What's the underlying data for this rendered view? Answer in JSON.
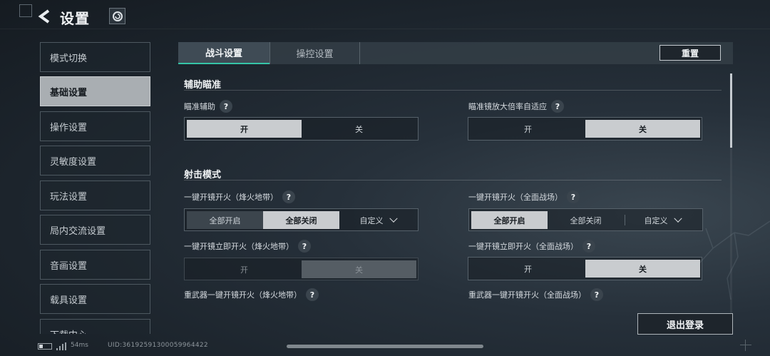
{
  "header": {
    "title": "设置"
  },
  "sidebar": {
    "items": [
      {
        "label": "模式切换",
        "active": false
      },
      {
        "label": "基础设置",
        "active": true
      },
      {
        "label": "操作设置",
        "active": false
      },
      {
        "label": "灵敏度设置",
        "active": false
      },
      {
        "label": "玩法设置",
        "active": false
      },
      {
        "label": "局内交流设置",
        "active": false
      },
      {
        "label": "音画设置",
        "active": false
      },
      {
        "label": "载具设置",
        "active": false
      },
      {
        "label": "下载中心",
        "active": false
      }
    ]
  },
  "tabs": [
    {
      "label": "战斗设置",
      "selected": true
    },
    {
      "label": "操控设置",
      "selected": false
    }
  ],
  "reset_label": "重置",
  "sections": {
    "aim_assist": {
      "title": "辅助瞄准",
      "left": {
        "label": "瞄准辅助",
        "on": "开",
        "off": "关",
        "value": "开"
      },
      "right": {
        "label": "瞄准镜放大倍率自适应",
        "on": "开",
        "off": "关",
        "value": "关"
      }
    },
    "fire_mode": {
      "title": "射击模式",
      "scope_fire_left": {
        "label": "一键开镜开火（烽火地带）",
        "options": [
          "全部开启",
          "全部关闭",
          "自定义"
        ],
        "value": "全部关闭"
      },
      "scope_fire_right": {
        "label": "一键开镜开火（全面战场）",
        "options": [
          "全部开启",
          "全部关闭",
          "自定义"
        ],
        "value": "全部开启"
      },
      "instant_fire_left": {
        "label": "一键开镜立即开火（烽火地带）",
        "on": "开",
        "off": "关",
        "value": "关",
        "disabled": true
      },
      "instant_fire_right": {
        "label": "一键开镜立即开火（全面战场）",
        "on": "开",
        "off": "关",
        "value": "关"
      },
      "heavy_left": {
        "label": "重武器一键开镜开火（烽火地带）"
      },
      "heavy_right": {
        "label": "重武器一键开镜开火（全面战场）"
      }
    }
  },
  "help_glyph": "?",
  "logout_label": "退出登录",
  "status": {
    "ping": "54ms",
    "uid": "UID:361925913000599644​22"
  },
  "colors": {
    "accent": "#35c4a7",
    "selected_option": "#c9cccf",
    "active_sidebar": "#a9aeb2"
  }
}
